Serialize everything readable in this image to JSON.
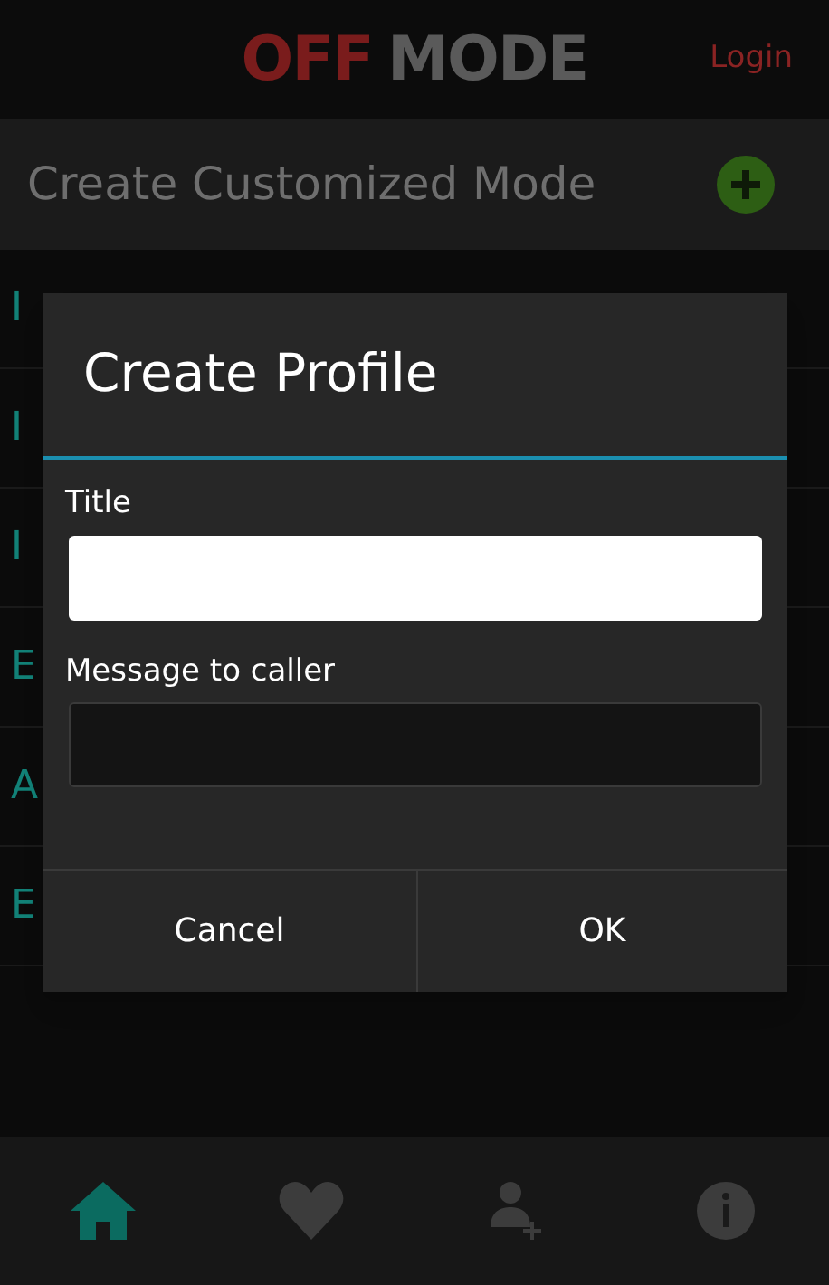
{
  "header": {
    "logo": [
      {
        "text": "OFF",
        "kind": "accent"
      },
      {
        "text": "MODE",
        "kind": "plain"
      }
    ],
    "login": "Login"
  },
  "toolbar": {
    "title": "Create Customized Mode"
  },
  "list": {
    "items": [
      {
        "label": "I"
      },
      {
        "label": "I"
      },
      {
        "label": "I"
      },
      {
        "label": "E"
      },
      {
        "label": "A"
      },
      {
        "label": "E"
      }
    ]
  },
  "dialog": {
    "title": "Create Profile",
    "fields": [
      {
        "label": "Title",
        "kind": "light"
      },
      {
        "label": "Message to caller",
        "kind": "dark"
      }
    ],
    "buttons": [
      "Cancel",
      "OK"
    ]
  },
  "nav": [
    {
      "kind": "home",
      "selected": true
    },
    {
      "kind": "heart",
      "selected": false
    },
    {
      "kind": "add-user",
      "selected": false
    },
    {
      "kind": "info",
      "selected": false
    }
  ]
}
